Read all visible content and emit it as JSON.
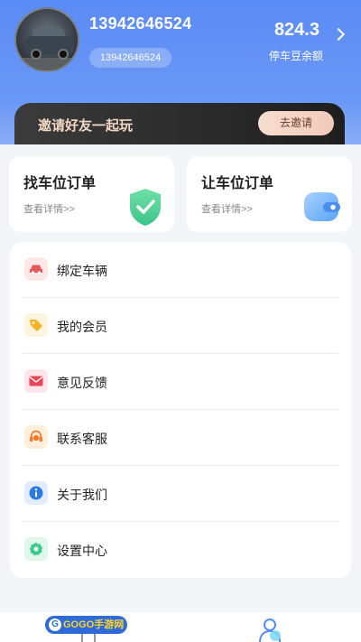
{
  "profile": {
    "phone": "13942646524",
    "phone_pill": "13942646524",
    "balance_value": "824.3",
    "balance_label": "停车豆余额"
  },
  "invite": {
    "text": "邀请好友一起玩",
    "button_label": "去邀请"
  },
  "cards": [
    {
      "title": "找车位订单",
      "subtitle": "查看详情>>",
      "icon": "shield-check-icon"
    },
    {
      "title": "让车位订单",
      "subtitle": "查看详情>>",
      "icon": "wallet-icon"
    }
  ],
  "menu": [
    {
      "label": "绑定车辆",
      "icon": "car-icon",
      "color": "#e55b5b"
    },
    {
      "label": "我的会员",
      "icon": "tag-icon",
      "color": "#f5b324"
    },
    {
      "label": "意见反馈",
      "icon": "mail-icon",
      "color": "#e5485a"
    },
    {
      "label": "联系客服",
      "icon": "headset-icon",
      "color": "#f07a2a"
    },
    {
      "label": "关于我们",
      "icon": "info-icon",
      "color": "#2c7be5"
    },
    {
      "label": "设置中心",
      "icon": "gear-icon",
      "color": "#3cc98a"
    }
  ],
  "tabbar": {
    "logo_text": "GOGO手游网"
  },
  "colors": {
    "header_top": "#5b8bf5",
    "invite_bg": "#2b2b2b",
    "invite_text": "#f1d7c4"
  }
}
